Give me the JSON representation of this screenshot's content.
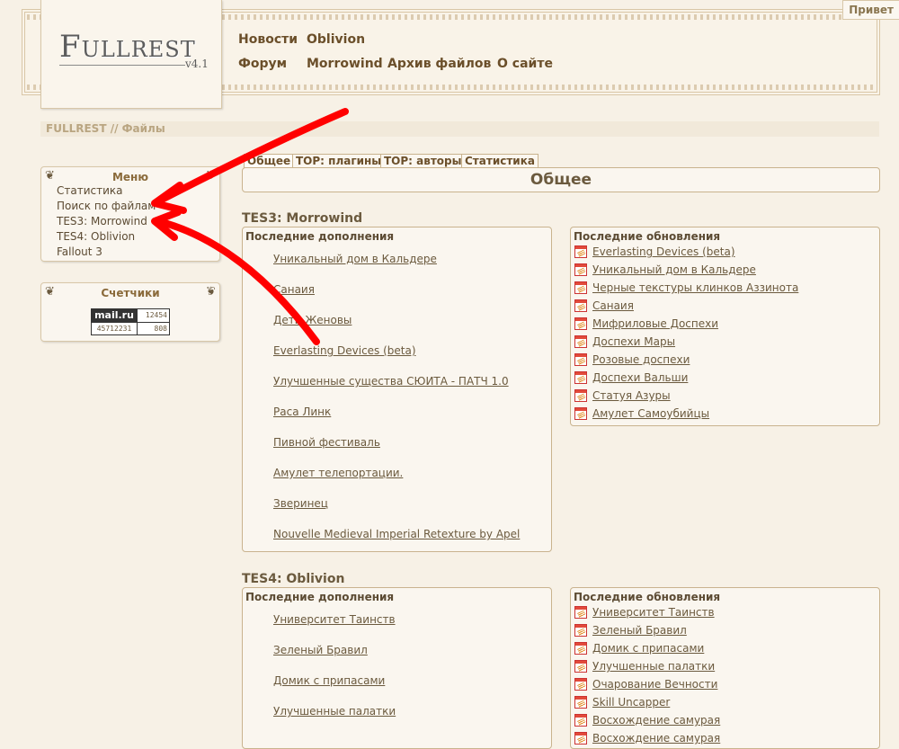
{
  "header": {
    "logo": "Fullrest",
    "logo_version": "v4.1",
    "greeting": "Привет",
    "nav": [
      "Новости",
      "Oblivion",
      "Форум",
      "Morrowind",
      "Архив файлов",
      "О сайте"
    ]
  },
  "breadcrumb": {
    "root": "FULLREST",
    "separator": "//",
    "current": "Файлы"
  },
  "sidebar": {
    "menu": {
      "title": "Меню",
      "items": [
        "Статистика",
        "Поиск по файлам",
        "TES3: Morrowind",
        "TES4: Oblivion",
        "Fallout 3"
      ]
    },
    "counters": {
      "title": "Счетчики",
      "widget": {
        "brand": "mail.ru",
        "top_right": "12454",
        "bottom_left": "45712231",
        "bottom_right": "808"
      }
    }
  },
  "tabs": [
    "Общее",
    "TOP: плагины",
    "TOP: авторы",
    "Статистика"
  ],
  "panel_title": "Общее",
  "sections": [
    {
      "title": "TES3: Morrowind",
      "additions_header": "Последние дополнения",
      "additions": [
        "Уникальный дом в Кальдере",
        "Санаия",
        "Дети Женовы",
        "Everlasting Devices (beta)",
        "Улучшенные существа СЮИТА - ПАТЧ 1.0",
        "Раса Линк",
        "Пивной фестиваль",
        "Амулет телепортации.",
        "Зверинец",
        "Nouvelle Medieval Imperial Retexture by Apel"
      ],
      "updates_header": "Последние обновления",
      "updates": [
        "Everlasting Devices (beta)",
        "Уникальный дом в Кальдере",
        "Черные текстуры клинков Аззинота",
        "Санаия",
        "Мифриловые Доспехи",
        "Доспехи Мары",
        "Розовые доспехи",
        "Доспехи Вальши",
        "Статуя Азуры",
        "Амулет Самоубийцы"
      ]
    },
    {
      "title": "TES4: Oblivion",
      "additions_header": "Последние дополнения",
      "additions": [
        "Университет Таинств",
        "Зеленый Бравил",
        "Домик с припасами",
        "Улучшенные палатки"
      ],
      "updates_header": "Последние обновления",
      "updates": [
        "Университет Таинств",
        "Зеленый Бравил",
        "Домик с припасами",
        "Улучшенные палатки",
        "Очарование Вечности",
        "Skill Uncapper",
        "Восхождение самурая"
      ]
    }
  ],
  "colors": {
    "annotation_arrow": "#ff0000",
    "page_bg": "#f7f1e6",
    "border": "#c9b38e"
  }
}
